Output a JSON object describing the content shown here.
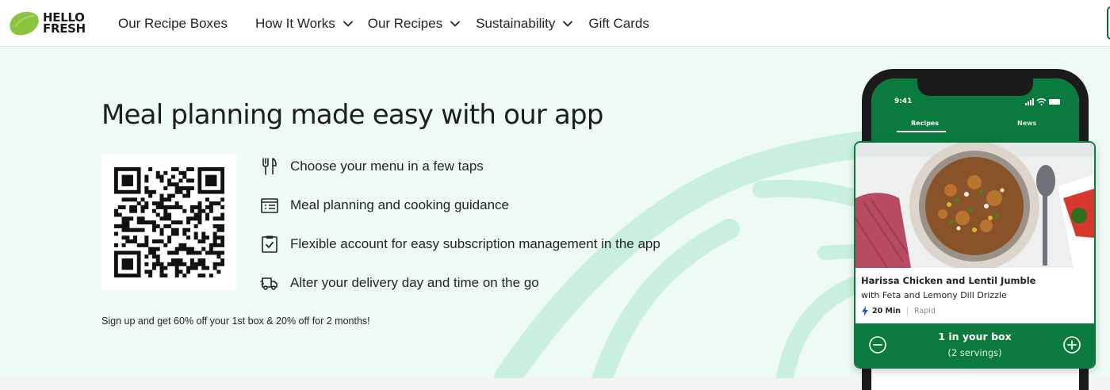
{
  "brand": {
    "logo_line1": "HELLO",
    "logo_line2": "FRESH",
    "logo_icon": "lime-icon",
    "colors": {
      "primary_green": "#0b7a3e",
      "lime": "#8bc53f",
      "hero_bg": "#eefaf4",
      "deco_mint": "#c9f0dd"
    }
  },
  "nav": {
    "items": [
      {
        "label": "Our Recipe Boxes",
        "has_dropdown": false
      },
      {
        "label": "How It Works",
        "has_dropdown": true
      },
      {
        "label": "Our Recipes",
        "has_dropdown": true
      },
      {
        "label": "Sustainability",
        "has_dropdown": true
      },
      {
        "label": "Gift Cards",
        "has_dropdown": false
      }
    ]
  },
  "hero": {
    "title": "Meal planning made easy with our app",
    "qr_icon": "qr-code-icon",
    "features": [
      {
        "icon": "fork-knife-icon",
        "text": "Choose your menu in a few taps"
      },
      {
        "icon": "recipe-card-icon",
        "text": "Meal planning and cooking guidance"
      },
      {
        "icon": "clipboard-check-icon",
        "text": "Flexible account for easy subscription management in the app"
      },
      {
        "icon": "delivery-truck-icon",
        "text": "Alter your delivery day and time on the go"
      }
    ],
    "promo": "Sign up and get 60% off your 1st box & 20% off for 2 months!"
  },
  "phone": {
    "time": "9:41",
    "status_icons": [
      "signal-icon",
      "wifi-icon",
      "battery-icon"
    ],
    "tabs": [
      "Recipes",
      "News"
    ],
    "recipe": {
      "name": "Harissa Chicken and Lentil Jumble",
      "subtitle": "with Feta and Lemony Dill Drizzle",
      "time": "20 Min",
      "tag": "Rapid",
      "time_icon": "lightning-icon"
    },
    "box": {
      "count_label": "1 in your box",
      "servings_label": "(2 servings)",
      "minus_icon": "minus-circle-icon",
      "plus_icon": "plus-circle-icon"
    }
  }
}
